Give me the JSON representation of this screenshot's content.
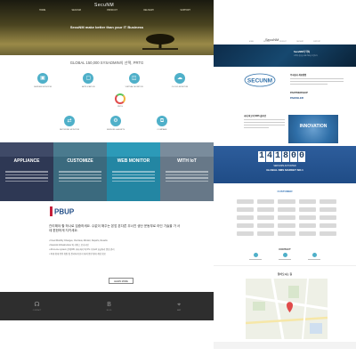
{
  "left_page": {
    "header": {
      "logo": "SecuNM",
      "nav": [
        "HOME",
        "SECUNM",
        "PRODUCT",
        "DELIVERY",
        "SUPPORT"
      ],
      "slogan": "SecuNM make better than your IT Business"
    },
    "global_title": "GLOBAL 150,000 SYSADMIN의 선택, PRTG",
    "features_row1": [
      {
        "icon": "server-icon",
        "glyph": "▣",
        "label": "SERVER MONITOR"
      },
      {
        "icon": "app-icon",
        "glyph": "▢",
        "label": "APPLICATION"
      },
      {
        "icon": "virtual-icon",
        "glyph": "◫",
        "label": "VIRTUAL MONITOR"
      },
      {
        "icon": "cloud-icon",
        "glyph": "☁",
        "label": "CLOUD MONITOR"
      }
    ],
    "center_badge_label": "PRTG",
    "features_row2": [
      {
        "icon": "network-icon",
        "glyph": "⇄",
        "label": "NETWORK MONITOR"
      },
      {
        "icon": "sensor-icon",
        "glyph": "⚙",
        "label": "SENSOR & ALERTS"
      },
      {
        "icon": "compare-icon",
        "glyph": "⧉",
        "label": "COMPARE"
      }
    ],
    "bands": [
      {
        "title": "APPLIANCE",
        "head": "#3f4a67",
        "body": "#2e3854"
      },
      {
        "title": "CUSTOMIZE",
        "head": "#4a7a8e",
        "body": "#3b6a7e"
      },
      {
        "title": "WEB MONITOR",
        "head": "#2c9ab8",
        "body": "#2386a3"
      },
      {
        "title": "WITH IoT",
        "head": "#7a8c9c",
        "body": "#677888"
      }
    ],
    "brand_mark": "PBUP",
    "intro_text": "관리해야 할 하나로 집중하세요. 수없이 해주는 본업 본다른 무너진 생산 운동부로 라인 기술을 가 서 데 편한하게 지키세요.",
    "bullets": [
      "• Fixed Monthly Changes, OneView, Monitor, Reports, Results",
      "• Network Infrastructure 와 서비스 모니터링",
      "• All-in-one system 관계 DB, 하나처리 와 OS 가 Ipv6 요금처리 알림 관리",
      "• 최대 확대 용량 확장 및 편리하게 유지 대처 용량 확대 계획 확보"
    ],
    "more_button": "LEARN MORE",
    "footer": [
      {
        "icon": "headset-icon",
        "glyph": "☊",
        "label": "CONTACT"
      },
      {
        "icon": "blog-icon",
        "glyph": "B",
        "label": "BLOG"
      },
      {
        "icon": "location-icon",
        "glyph": "⌖",
        "label": "MAP"
      }
    ]
  },
  "right_page": {
    "header": {
      "logo": "SecuNM",
      "nav": [
        "HOME",
        "SECUNM",
        "PRODUCT",
        "DELIVERY",
        "SUPPORT"
      ],
      "hero_title": "SecuNM의 약속",
      "hero_sub": "고객의 성공을 위해 최선을 다합니다"
    },
    "secunm_logo": "SECUNM",
    "about_heading": "주식회사 세큐엔엠",
    "partnership": "PARTNERSHIP",
    "partner_brand": "PAESSLER",
    "intro_heading": "국내 최고의 NMS 솔루션",
    "innovation_label": "INNOVATION",
    "counter": {
      "digits": [
        "1",
        "4",
        "1",
        "8",
        "0",
        "0"
      ],
      "label1": "SENSORS ACTIVATED",
      "label2": "GLOBAL NMS MARKET NO.1"
    },
    "customer_title": "CUSTOMER",
    "contact_title": "CONTACT",
    "location_title": "찾아오시는 길"
  },
  "colors": {
    "accent": "#4fb0c9",
    "counter_bg": "#1f4c86",
    "footer_bg": "#2e2e2e"
  }
}
